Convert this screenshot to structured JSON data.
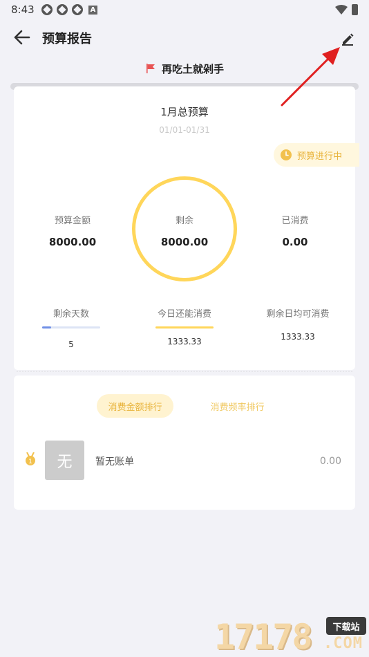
{
  "status_bar": {
    "time": "8:43",
    "badge_letter": "A"
  },
  "nav": {
    "title": "预算报告"
  },
  "book": {
    "name": "再吃土就剁手"
  },
  "budget": {
    "title": "1月总预算",
    "date_range": "01/01-01/31",
    "status": "预算进行中",
    "budget_amount_label": "预算金额",
    "budget_amount": "8000.00",
    "remaining_label": "剩余",
    "remaining": "8000.00",
    "spent_label": "已消费",
    "spent": "0.00",
    "days_left_label": "剩余天数",
    "days_left": "5",
    "days_left_fraction": 0.16,
    "today_spend_label": "今日还能消费",
    "today_spend": "1333.33",
    "daily_avg_label": "剩余日均可消费",
    "daily_avg": "1333.33"
  },
  "ranking": {
    "tab_amount": "消费金额排行",
    "tab_frequency": "消费频率排行",
    "empty_avatar": "无",
    "empty_label": "暂无账单",
    "empty_amount": "0.00"
  },
  "watermark": {
    "digits": "17178",
    "badge": "下载站",
    "com": ".COM"
  },
  "colors": {
    "accent_yellow": "#FFD65A",
    "accent_text": "#E8B33A",
    "progress_blue": "#6F8FE6",
    "annotation_red": "#E02020"
  }
}
